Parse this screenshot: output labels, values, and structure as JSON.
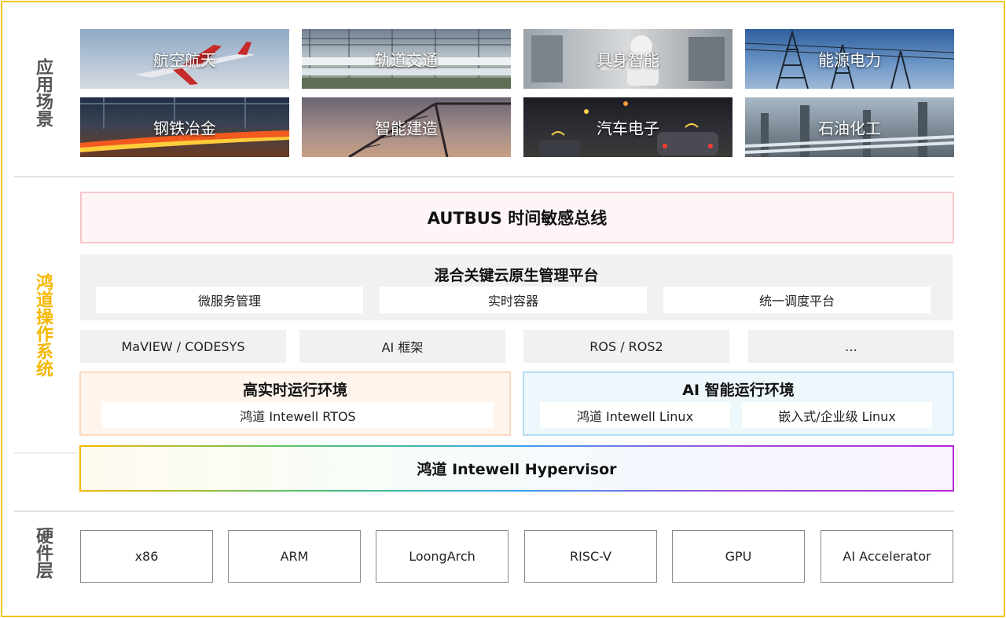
{
  "sections": {
    "scenarios": "应用场景",
    "os": "鸿道操作系统",
    "hardware": "硬件层"
  },
  "scenarios": [
    {
      "label": "航空航天",
      "icon": "airplane-photo"
    },
    {
      "label": "轨道交通",
      "icon": "high-speed-train-photo"
    },
    {
      "label": "具身智能",
      "icon": "humanoid-robot-photo"
    },
    {
      "label": "能源电力",
      "icon": "power-tower-photo"
    },
    {
      "label": "钢铁冶金",
      "icon": "steel-mill-photo"
    },
    {
      "label": "智能建造",
      "icon": "construction-crane-photo"
    },
    {
      "label": "汽车电子",
      "icon": "connected-cars-photo"
    },
    {
      "label": "石油化工",
      "icon": "refinery-photo"
    }
  ],
  "autbus": "AUTBUS  时间敏感总线",
  "platform": {
    "title": "混合关键云原生管理平台",
    "items": [
      "微服务管理",
      "实时容器",
      "统一调度平台"
    ]
  },
  "frameworks": [
    "MaVIEW / CODESYS",
    "AI 框架",
    "ROS / ROS2",
    "…"
  ],
  "rt_env": {
    "title": "高实时运行环境",
    "items": [
      "鸿道 Intewell RTOS"
    ]
  },
  "ai_env": {
    "title": "AI 智能运行环境",
    "items": [
      "鸿道 Intewell Linux",
      "嵌入式/企业级 Linux"
    ]
  },
  "hypervisor": "鸿道 Intewell Hypervisor",
  "hardware": [
    "x86",
    "ARM",
    "LoongArch",
    "RISC-V",
    "GPU",
    "AI Accelerator"
  ],
  "colors": {
    "frame": "#f7c31a",
    "os_label": "#f5b800",
    "autbus_border": "#f7c6cb",
    "rt_border": "#fbd9bf",
    "ai_border": "#b7def2"
  }
}
